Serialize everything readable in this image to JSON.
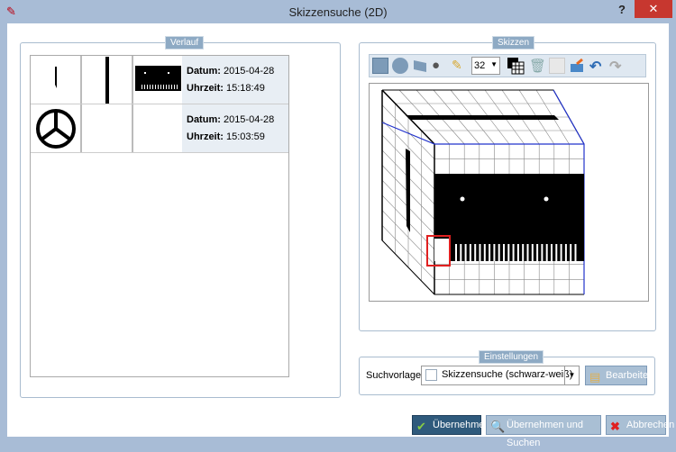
{
  "window": {
    "title": "Skizzensuche (2D)",
    "help": "?",
    "close": "✕"
  },
  "history": {
    "legend": "Verlauf",
    "entries": [
      {
        "date_label": "Datum:",
        "date": "2015-04-28",
        "time_label": "Uhrzeit:",
        "time": "15:18:49"
      },
      {
        "date_label": "Datum:",
        "date": "2015-04-28",
        "time_label": "Uhrzeit:",
        "time": "15:03:59"
      }
    ]
  },
  "sketches": {
    "legend": "Skizzen",
    "pen_size": "32"
  },
  "settings": {
    "legend": "Einstellungen",
    "template_label": "Suchvorlage:",
    "template_value": "Skizzensuche (schwarz-weiß)",
    "edit": "Bearbeiten"
  },
  "footer": {
    "apply": "Übernehmen",
    "apply_search": "Übernehmen und Suchen",
    "cancel": "Abbrechen"
  },
  "colors": {
    "accent": "#2f5a7c",
    "selection": "#e02020"
  }
}
